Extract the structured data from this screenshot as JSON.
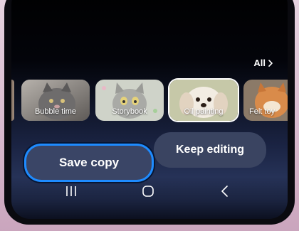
{
  "styles_header": {
    "all_label": "All"
  },
  "styles": [
    {
      "label": "Bubble time"
    },
    {
      "label": "Storybook"
    },
    {
      "label": "Oil painting",
      "selected": true
    },
    {
      "label": "Felt toy"
    }
  ],
  "actions": {
    "save_label": "Save copy",
    "keep_label": "Keep editing"
  },
  "colors": {
    "accent": "#1e8bff",
    "button_bg": "#3a4566",
    "device_frame": "#d7b8cc"
  },
  "icons": [
    "chevron-right-icon",
    "recent-apps-icon",
    "home-icon",
    "back-icon"
  ]
}
